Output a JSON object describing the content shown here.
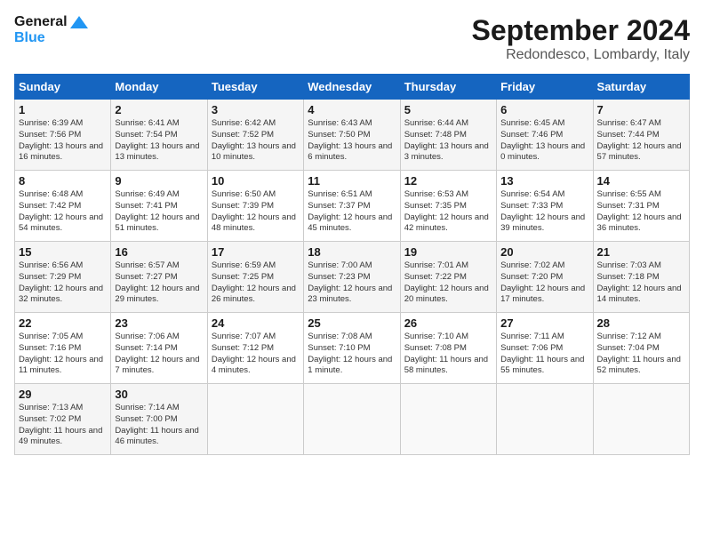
{
  "header": {
    "logo_line1": "General",
    "logo_line2": "Blue",
    "month_title": "September 2024",
    "location": "Redondesco, Lombardy, Italy"
  },
  "weekdays": [
    "Sunday",
    "Monday",
    "Tuesday",
    "Wednesday",
    "Thursday",
    "Friday",
    "Saturday"
  ],
  "weeks": [
    [
      {
        "day": "1",
        "sunrise": "Sunrise: 6:39 AM",
        "sunset": "Sunset: 7:56 PM",
        "daylight": "Daylight: 13 hours and 16 minutes."
      },
      {
        "day": "2",
        "sunrise": "Sunrise: 6:41 AM",
        "sunset": "Sunset: 7:54 PM",
        "daylight": "Daylight: 13 hours and 13 minutes."
      },
      {
        "day": "3",
        "sunrise": "Sunrise: 6:42 AM",
        "sunset": "Sunset: 7:52 PM",
        "daylight": "Daylight: 13 hours and 10 minutes."
      },
      {
        "day": "4",
        "sunrise": "Sunrise: 6:43 AM",
        "sunset": "Sunset: 7:50 PM",
        "daylight": "Daylight: 13 hours and 6 minutes."
      },
      {
        "day": "5",
        "sunrise": "Sunrise: 6:44 AM",
        "sunset": "Sunset: 7:48 PM",
        "daylight": "Daylight: 13 hours and 3 minutes."
      },
      {
        "day": "6",
        "sunrise": "Sunrise: 6:45 AM",
        "sunset": "Sunset: 7:46 PM",
        "daylight": "Daylight: 13 hours and 0 minutes."
      },
      {
        "day": "7",
        "sunrise": "Sunrise: 6:47 AM",
        "sunset": "Sunset: 7:44 PM",
        "daylight": "Daylight: 12 hours and 57 minutes."
      }
    ],
    [
      {
        "day": "8",
        "sunrise": "Sunrise: 6:48 AM",
        "sunset": "Sunset: 7:42 PM",
        "daylight": "Daylight: 12 hours and 54 minutes."
      },
      {
        "day": "9",
        "sunrise": "Sunrise: 6:49 AM",
        "sunset": "Sunset: 7:41 PM",
        "daylight": "Daylight: 12 hours and 51 minutes."
      },
      {
        "day": "10",
        "sunrise": "Sunrise: 6:50 AM",
        "sunset": "Sunset: 7:39 PM",
        "daylight": "Daylight: 12 hours and 48 minutes."
      },
      {
        "day": "11",
        "sunrise": "Sunrise: 6:51 AM",
        "sunset": "Sunset: 7:37 PM",
        "daylight": "Daylight: 12 hours and 45 minutes."
      },
      {
        "day": "12",
        "sunrise": "Sunrise: 6:53 AM",
        "sunset": "Sunset: 7:35 PM",
        "daylight": "Daylight: 12 hours and 42 minutes."
      },
      {
        "day": "13",
        "sunrise": "Sunrise: 6:54 AM",
        "sunset": "Sunset: 7:33 PM",
        "daylight": "Daylight: 12 hours and 39 minutes."
      },
      {
        "day": "14",
        "sunrise": "Sunrise: 6:55 AM",
        "sunset": "Sunset: 7:31 PM",
        "daylight": "Daylight: 12 hours and 36 minutes."
      }
    ],
    [
      {
        "day": "15",
        "sunrise": "Sunrise: 6:56 AM",
        "sunset": "Sunset: 7:29 PM",
        "daylight": "Daylight: 12 hours and 32 minutes."
      },
      {
        "day": "16",
        "sunrise": "Sunrise: 6:57 AM",
        "sunset": "Sunset: 7:27 PM",
        "daylight": "Daylight: 12 hours and 29 minutes."
      },
      {
        "day": "17",
        "sunrise": "Sunrise: 6:59 AM",
        "sunset": "Sunset: 7:25 PM",
        "daylight": "Daylight: 12 hours and 26 minutes."
      },
      {
        "day": "18",
        "sunrise": "Sunrise: 7:00 AM",
        "sunset": "Sunset: 7:23 PM",
        "daylight": "Daylight: 12 hours and 23 minutes."
      },
      {
        "day": "19",
        "sunrise": "Sunrise: 7:01 AM",
        "sunset": "Sunset: 7:22 PM",
        "daylight": "Daylight: 12 hours and 20 minutes."
      },
      {
        "day": "20",
        "sunrise": "Sunrise: 7:02 AM",
        "sunset": "Sunset: 7:20 PM",
        "daylight": "Daylight: 12 hours and 17 minutes."
      },
      {
        "day": "21",
        "sunrise": "Sunrise: 7:03 AM",
        "sunset": "Sunset: 7:18 PM",
        "daylight": "Daylight: 12 hours and 14 minutes."
      }
    ],
    [
      {
        "day": "22",
        "sunrise": "Sunrise: 7:05 AM",
        "sunset": "Sunset: 7:16 PM",
        "daylight": "Daylight: 12 hours and 11 minutes."
      },
      {
        "day": "23",
        "sunrise": "Sunrise: 7:06 AM",
        "sunset": "Sunset: 7:14 PM",
        "daylight": "Daylight: 12 hours and 7 minutes."
      },
      {
        "day": "24",
        "sunrise": "Sunrise: 7:07 AM",
        "sunset": "Sunset: 7:12 PM",
        "daylight": "Daylight: 12 hours and 4 minutes."
      },
      {
        "day": "25",
        "sunrise": "Sunrise: 7:08 AM",
        "sunset": "Sunset: 7:10 PM",
        "daylight": "Daylight: 12 hours and 1 minute."
      },
      {
        "day": "26",
        "sunrise": "Sunrise: 7:10 AM",
        "sunset": "Sunset: 7:08 PM",
        "daylight": "Daylight: 11 hours and 58 minutes."
      },
      {
        "day": "27",
        "sunrise": "Sunrise: 7:11 AM",
        "sunset": "Sunset: 7:06 PM",
        "daylight": "Daylight: 11 hours and 55 minutes."
      },
      {
        "day": "28",
        "sunrise": "Sunrise: 7:12 AM",
        "sunset": "Sunset: 7:04 PM",
        "daylight": "Daylight: 11 hours and 52 minutes."
      }
    ],
    [
      {
        "day": "29",
        "sunrise": "Sunrise: 7:13 AM",
        "sunset": "Sunset: 7:02 PM",
        "daylight": "Daylight: 11 hours and 49 minutes."
      },
      {
        "day": "30",
        "sunrise": "Sunrise: 7:14 AM",
        "sunset": "Sunset: 7:00 PM",
        "daylight": "Daylight: 11 hours and 46 minutes."
      },
      {
        "day": "",
        "sunrise": "",
        "sunset": "",
        "daylight": ""
      },
      {
        "day": "",
        "sunrise": "",
        "sunset": "",
        "daylight": ""
      },
      {
        "day": "",
        "sunrise": "",
        "sunset": "",
        "daylight": ""
      },
      {
        "day": "",
        "sunrise": "",
        "sunset": "",
        "daylight": ""
      },
      {
        "day": "",
        "sunrise": "",
        "sunset": "",
        "daylight": ""
      }
    ]
  ]
}
